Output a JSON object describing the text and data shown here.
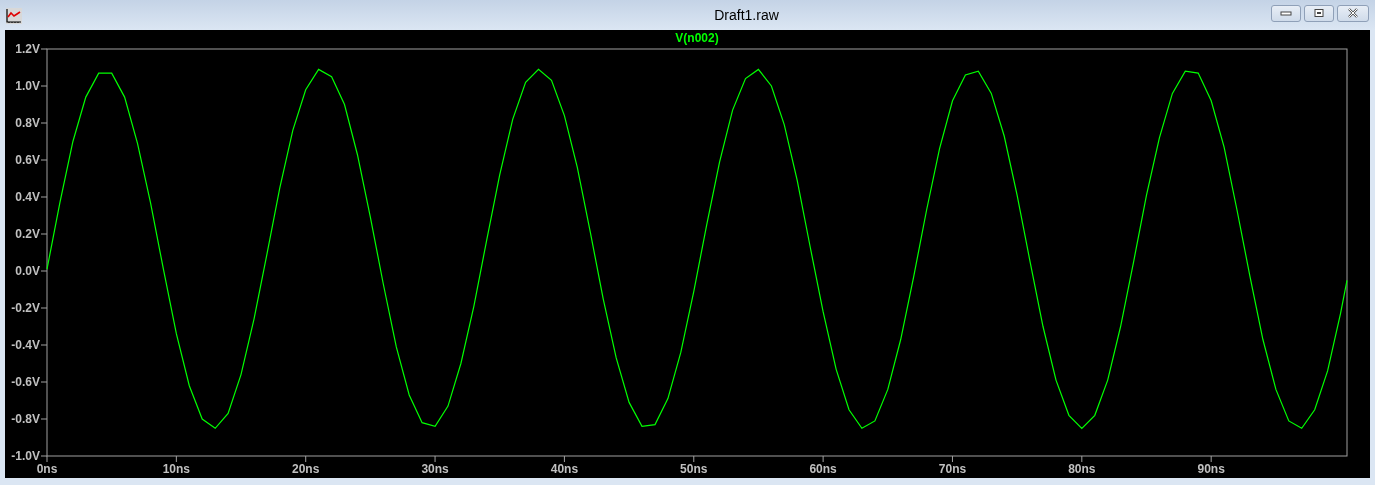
{
  "window": {
    "title": "Draft1.raw"
  },
  "plot": {
    "chart_data": {
      "type": "line",
      "xlim": [
        0,
        100.5
      ],
      "ylim": [
        -1,
        1.2
      ],
      "xticks": [
        {
          "value": 0,
          "label": "0ns"
        },
        {
          "value": 10,
          "label": "10ns"
        },
        {
          "value": 20,
          "label": "20ns"
        },
        {
          "value": 30,
          "label": "30ns"
        },
        {
          "value": 40,
          "label": "40ns"
        },
        {
          "value": 50,
          "label": "50ns"
        },
        {
          "value": 60,
          "label": "60ns"
        },
        {
          "value": 70,
          "label": "70ns"
        },
        {
          "value": 80,
          "label": "80ns"
        },
        {
          "value": 90,
          "label": "90ns"
        }
      ],
      "yticks": [
        {
          "value": 1.2,
          "label": "1.2V"
        },
        {
          "value": 1.0,
          "label": "1.0V"
        },
        {
          "value": 0.8,
          "label": "0.8V"
        },
        {
          "value": 0.6,
          "label": "0.6V"
        },
        {
          "value": 0.4,
          "label": "0.4V"
        },
        {
          "value": 0.2,
          "label": "0.2V"
        },
        {
          "value": 0.0,
          "label": "0.0V"
        },
        {
          "value": -0.2,
          "label": "-0.2V"
        },
        {
          "value": -0.4,
          "label": "-0.4V"
        },
        {
          "value": -0.6,
          "label": "-0.6V"
        },
        {
          "value": -0.8,
          "label": "-0.8V"
        },
        {
          "value": -1.0,
          "label": "-1.0V"
        }
      ],
      "x": [
        0,
        1,
        2,
        3,
        4,
        5,
        6,
        7,
        8,
        9,
        10,
        11,
        12,
        13,
        14,
        15,
        16,
        17,
        18,
        19,
        20,
        21,
        22,
        23,
        24,
        25,
        26,
        27,
        28,
        29,
        30,
        31,
        32,
        33,
        34,
        35,
        36,
        37,
        38,
        39,
        40,
        41,
        42,
        43,
        44,
        45,
        46,
        47,
        48,
        49,
        50,
        51,
        52,
        53,
        54,
        55,
        56,
        57,
        58,
        59,
        60,
        61,
        62,
        63,
        64,
        65,
        66,
        67,
        68,
        69,
        70,
        71,
        72,
        73,
        74,
        75,
        76,
        77,
        78,
        79,
        80,
        81,
        82,
        83,
        84,
        85,
        86,
        87,
        88,
        89,
        90,
        91,
        92,
        93,
        94,
        95,
        96,
        97,
        98,
        99,
        100,
        100.5
      ],
      "series": [
        {
          "name": "V(n002)",
          "color": "#00ff00",
          "values": [
            0.01,
            0.37,
            0.7,
            0.94,
            1.07,
            1.07,
            0.94,
            0.69,
            0.37,
            0.01,
            -0.34,
            -0.62,
            -0.8,
            -0.85,
            -0.77,
            -0.56,
            -0.26,
            0.09,
            0.45,
            0.76,
            0.98,
            1.09,
            1.05,
            0.9,
            0.63,
            0.29,
            -0.07,
            -0.41,
            -0.67,
            -0.82,
            -0.84,
            -0.73,
            -0.5,
            -0.19,
            0.17,
            0.52,
            0.82,
            1.02,
            1.09,
            1.03,
            0.84,
            0.56,
            0.21,
            -0.15,
            -0.47,
            -0.71,
            -0.84,
            -0.83,
            -0.69,
            -0.44,
            -0.11,
            0.25,
            0.59,
            0.87,
            1.04,
            1.09,
            1.0,
            0.79,
            0.49,
            0.13,
            -0.22,
            -0.53,
            -0.75,
            -0.85,
            -0.81,
            -0.64,
            -0.37,
            -0.03,
            0.33,
            0.66,
            0.92,
            1.06,
            1.08,
            0.96,
            0.73,
            0.41,
            0.05,
            -0.3,
            -0.59,
            -0.78,
            -0.85,
            -0.78,
            -0.59,
            -0.3,
            0.05,
            0.41,
            0.72,
            0.96,
            1.08,
            1.07,
            0.92,
            0.67,
            0.33,
            -0.03,
            -0.37,
            -0.64,
            -0.81,
            -0.85,
            -0.75,
            -0.54,
            -0.23,
            -0.05
          ]
        }
      ]
    }
  }
}
